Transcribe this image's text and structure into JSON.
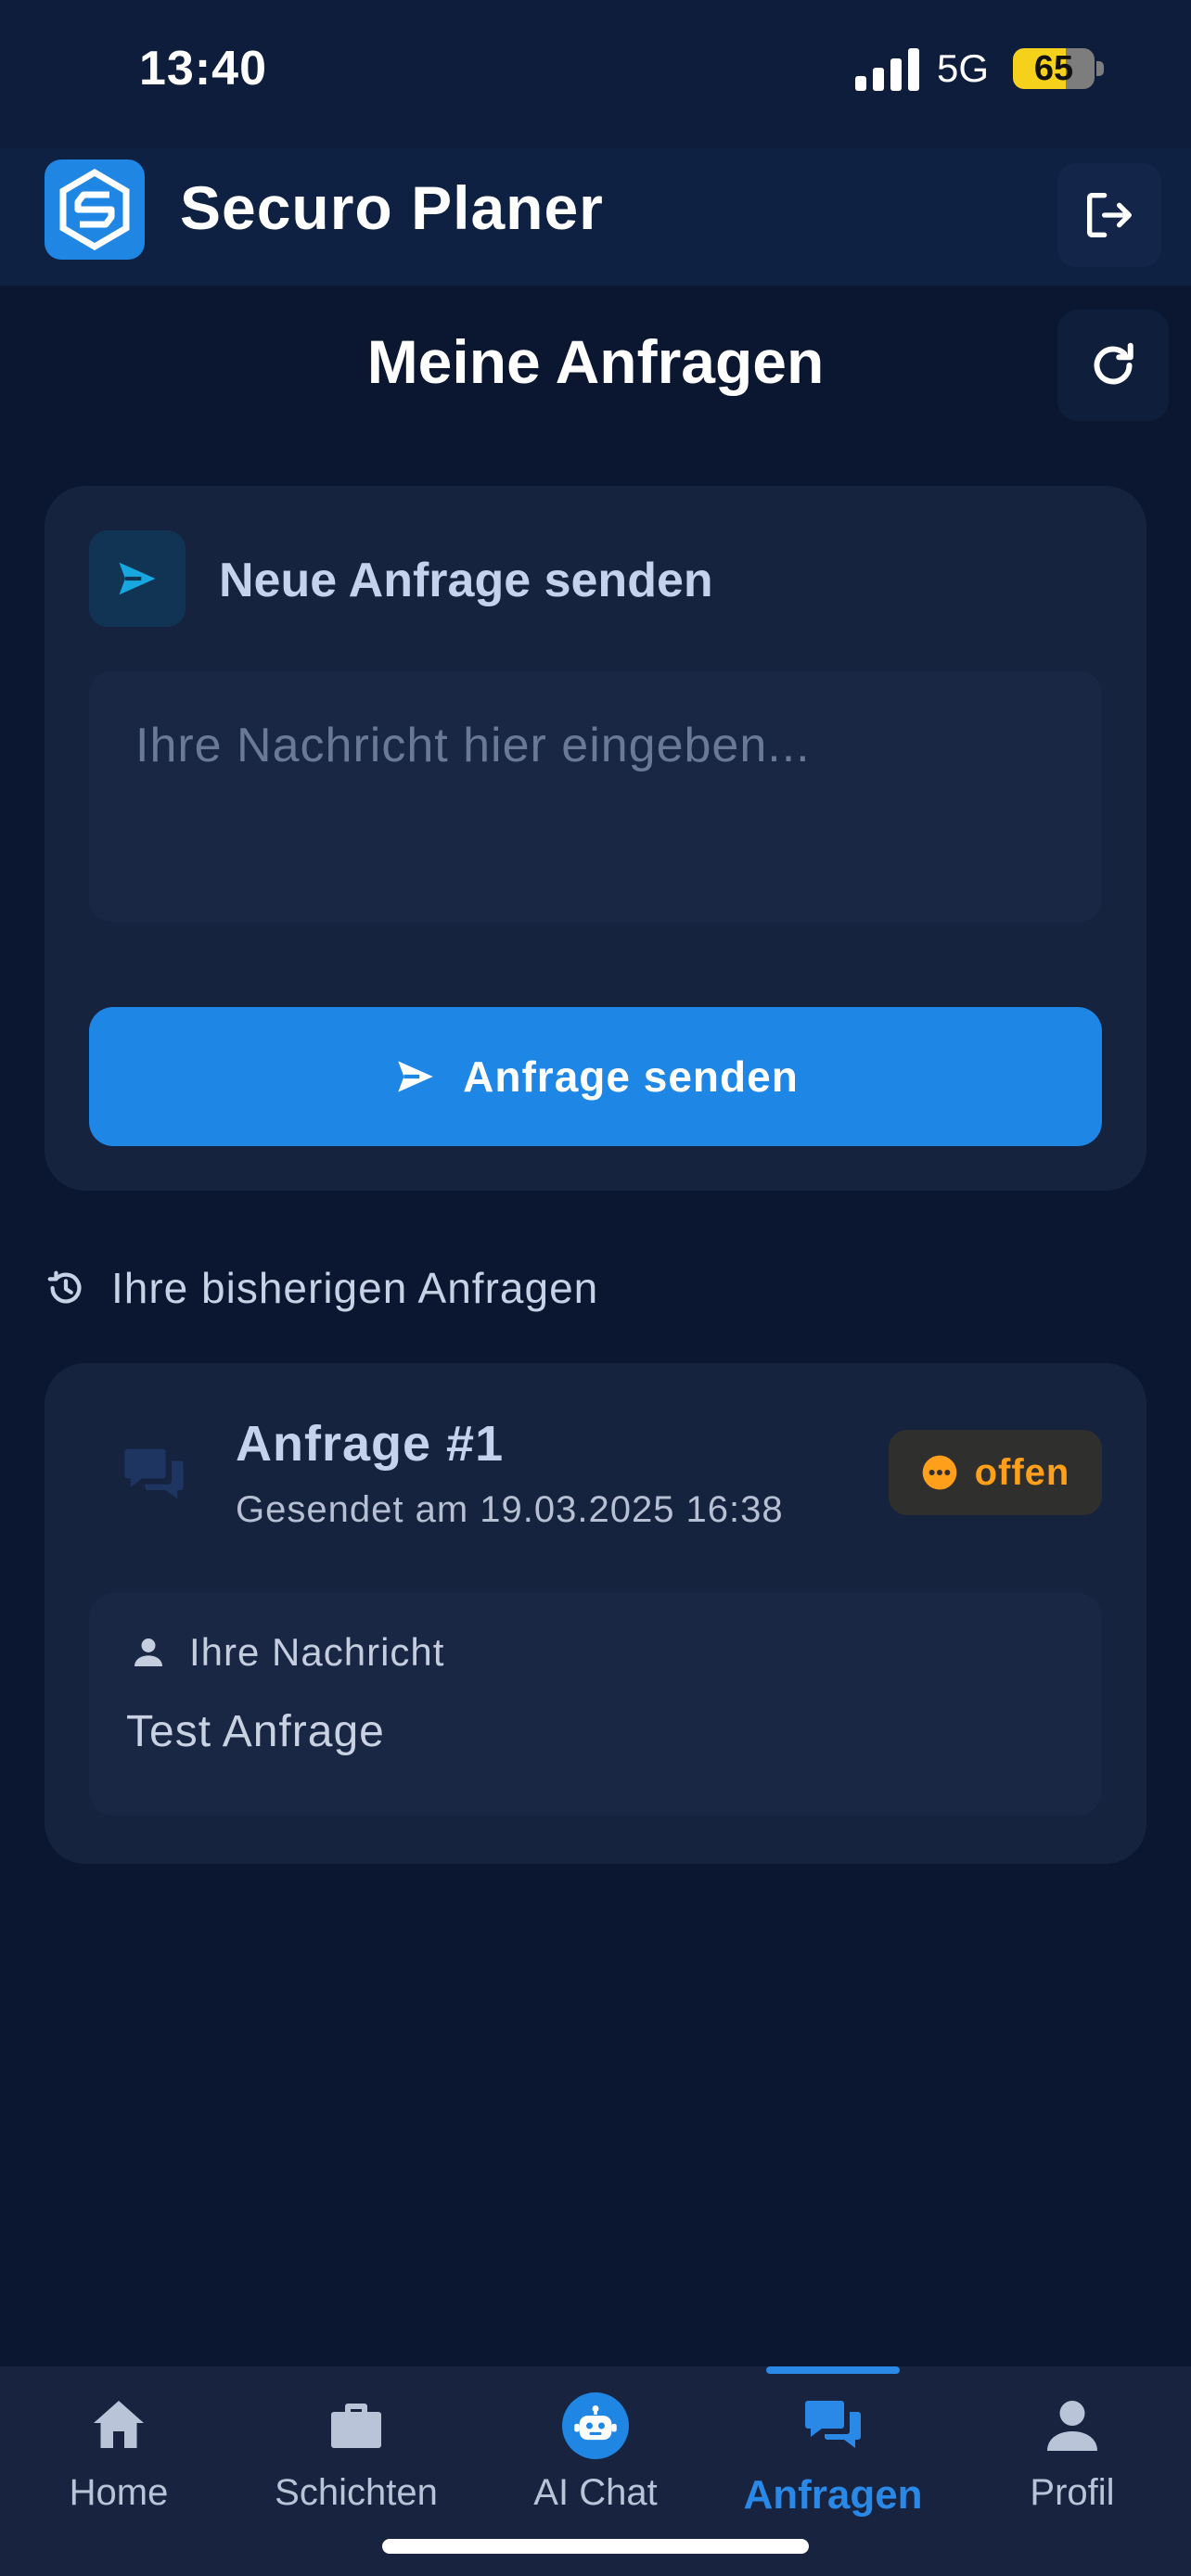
{
  "status_bar": {
    "time": "13:40",
    "network": "5G",
    "battery": "65",
    "battery_level": 0.65
  },
  "header": {
    "app_title": "Securo Planer"
  },
  "page": {
    "title": "Meine Anfragen"
  },
  "new_request": {
    "title": "Neue Anfrage senden",
    "input_placeholder": "Ihre Nachricht hier eingeben...",
    "input_value": "",
    "send_label": "Anfrage senden"
  },
  "history": {
    "heading": "Ihre bisherigen Anfragen",
    "requests": [
      {
        "title": "Anfrage #1",
        "date": "Gesendet am 19.03.2025 16:38",
        "status": "offen",
        "message_label": "Ihre Nachricht",
        "message": "Test Anfrage"
      }
    ]
  },
  "nav": {
    "items": [
      {
        "label": "Home",
        "icon": "home-icon"
      },
      {
        "label": "Schichten",
        "icon": "briefcase-icon"
      },
      {
        "label": "AI Chat",
        "icon": "robot-icon"
      },
      {
        "label": "Anfragen",
        "icon": "chat-bubbles-icon",
        "active": true
      },
      {
        "label": "Profil",
        "icon": "person-icon"
      }
    ]
  },
  "colors": {
    "background": "#0b1730",
    "card": "#16233f",
    "accent": "#1e86e5",
    "status_open": "#ff9f1a"
  }
}
